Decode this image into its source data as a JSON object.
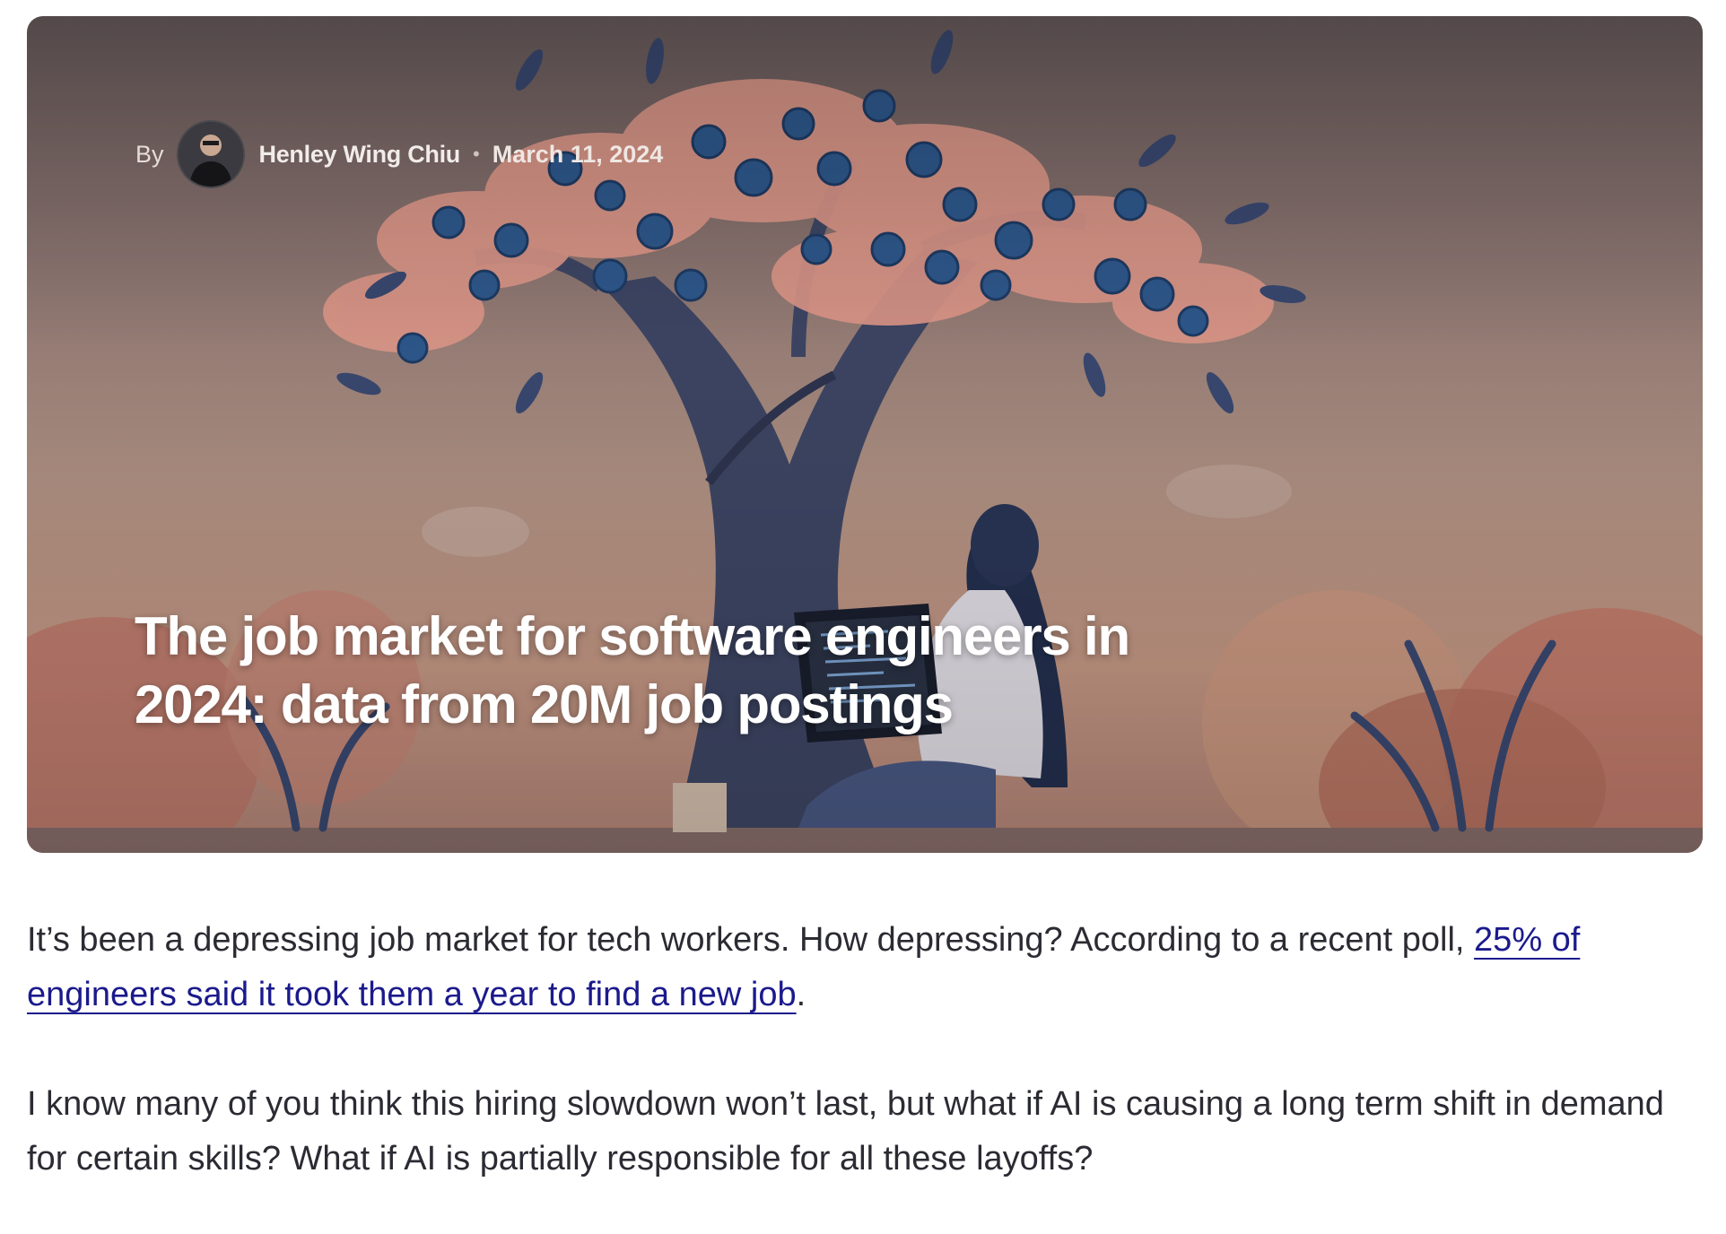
{
  "hero": {
    "byline_prefix": "By",
    "author": "Henley Wing Chiu",
    "separator": "•",
    "date": "March 11, 2024",
    "title": "The job market for software engineers in 2024: data from 20M job postings",
    "image_icon": "tree-illustration"
  },
  "article": {
    "p1_text": "It’s been a depressing job market for tech workers. How depressing? According to a recent poll, ",
    "p1_link": "25% of engineers said it took them a year to find a new job",
    "p1_end": ".",
    "p2_text": "I know many of you think this hiring slowdown won’t last, but what if AI is causing a long term shift in demand for certain skills? What if AI is partially responsible for all these layoffs?"
  },
  "colors": {
    "link": "#1b1a8c",
    "body_text": "#2b2b33",
    "berry": "#2f5a8f",
    "blossom": "#e39b8c"
  }
}
